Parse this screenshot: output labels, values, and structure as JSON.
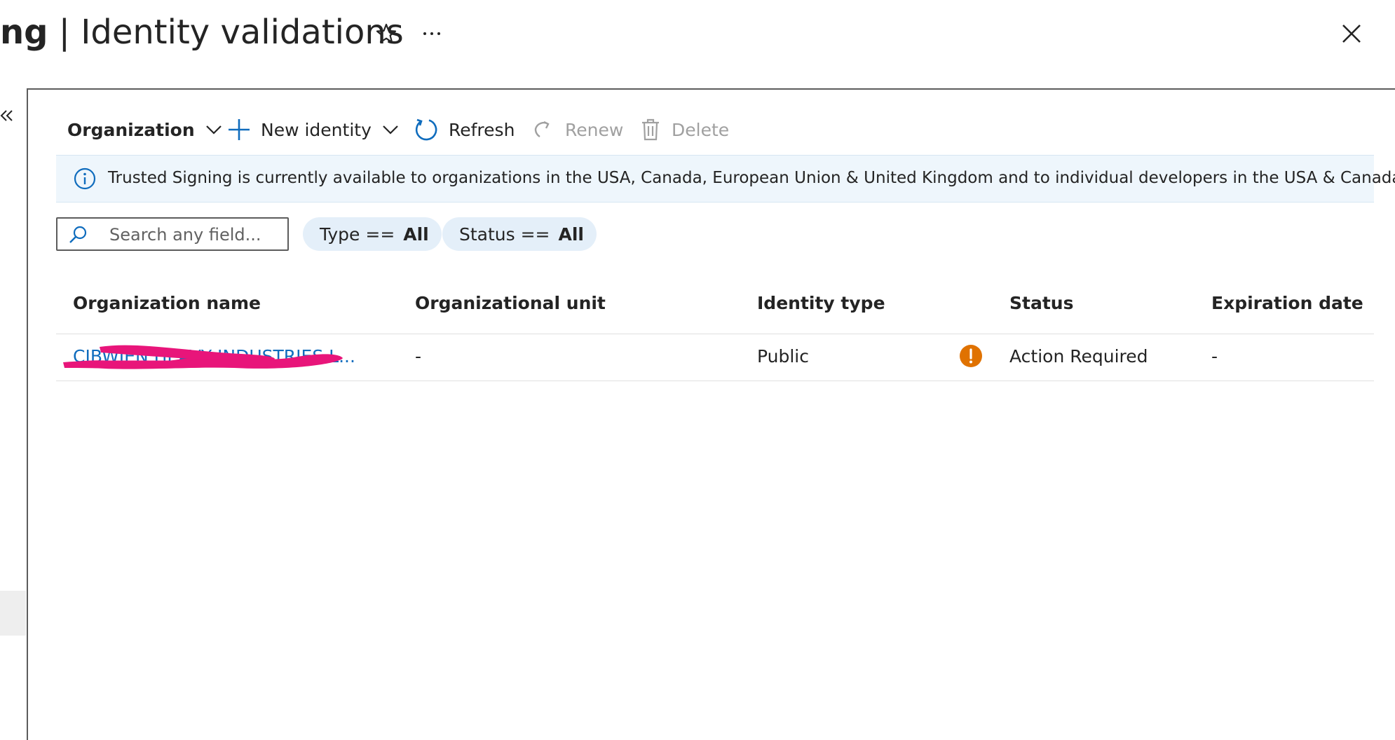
{
  "header": {
    "title_bold": "ng",
    "title_sep": " | ",
    "title": "Identity validations",
    "favorite_icon": "star-icon",
    "more_icon": "ellipsis-icon",
    "close_icon": "close-icon"
  },
  "nav": {
    "collapse_icon": "double-chevron-left-icon"
  },
  "toolbar": {
    "organization_label": "Organization",
    "new_identity_label": "New identity",
    "refresh_label": "Refresh",
    "renew_label": "Renew",
    "delete_label": "Delete"
  },
  "info_banner": {
    "icon": "info-icon",
    "text": "Trusted Signing is currently available to organizations in the USA, Canada, European Union & United Kingdom and to individual developers in the USA & Canada."
  },
  "filters": {
    "search_placeholder": "Search any field...",
    "search_value": "",
    "type_label": "Type ==",
    "type_value": "All",
    "status_label": "Status ==",
    "status_value": "All"
  },
  "table": {
    "columns": [
      "Organization name",
      "Organizational unit",
      "Identity type",
      "Status",
      "Expiration date"
    ],
    "rows": [
      {
        "organization_name": "CIBWIEN HEAVY INDUSTRIES L...",
        "organizational_unit": "-",
        "identity_type": "Public",
        "status_icon": "warning-circle-icon",
        "status": "Action Required",
        "expiration_date": "-"
      }
    ]
  },
  "colors": {
    "accent": "#0f6cbd",
    "warning": "#e07200",
    "info_background": "#eef6fc",
    "pill_background": "#e4eff9",
    "redaction": "#e8157a"
  }
}
